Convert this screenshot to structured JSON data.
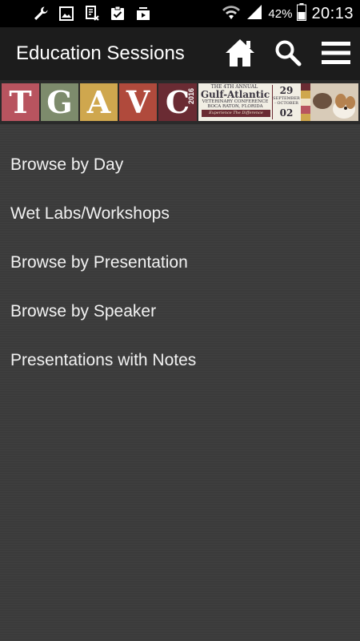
{
  "status_bar": {
    "icons": [
      "wrench-icon",
      "gallery-icon",
      "screenshot-icon",
      "clipboard-icon",
      "media-icon"
    ],
    "battery_pct": "42%",
    "clock": "20:13"
  },
  "app_bar": {
    "title": "Education Sessions",
    "icons": [
      "home-icon",
      "search-icon",
      "menu-icon"
    ]
  },
  "banner": {
    "letters": [
      "T",
      "G",
      "A",
      "V",
      "C"
    ],
    "year": "2016",
    "annual": "THE 4TH ANNUAL",
    "name": "Gulf-Atlantic",
    "subtitle": "VETERINARY CONFERENCE",
    "location": "BOCA RATON, FLORIDA",
    "tagline": "Experience The Difference",
    "date_start": "29",
    "date_months": "SEPTEMBER - OCTOBER",
    "date_end": "02",
    "colors": {
      "pink": "#b8545f",
      "sage": "#7d8b6c",
      "gold": "#cfa74e",
      "rust": "#b04a3c",
      "plum": "#6a2b33"
    }
  },
  "menu": {
    "items": [
      {
        "label": "Browse by Day"
      },
      {
        "label": "Wet Labs/Workshops"
      },
      {
        "label": "Browse by Presentation"
      },
      {
        "label": "Browse by Speaker"
      },
      {
        "label": "Presentations with Notes"
      }
    ]
  },
  "colors": {
    "status_bar_bg": "#000000",
    "app_bar_bg": "#1c1c1c",
    "content_bg": "#3c3c3c",
    "text": "#f2f2f2"
  }
}
